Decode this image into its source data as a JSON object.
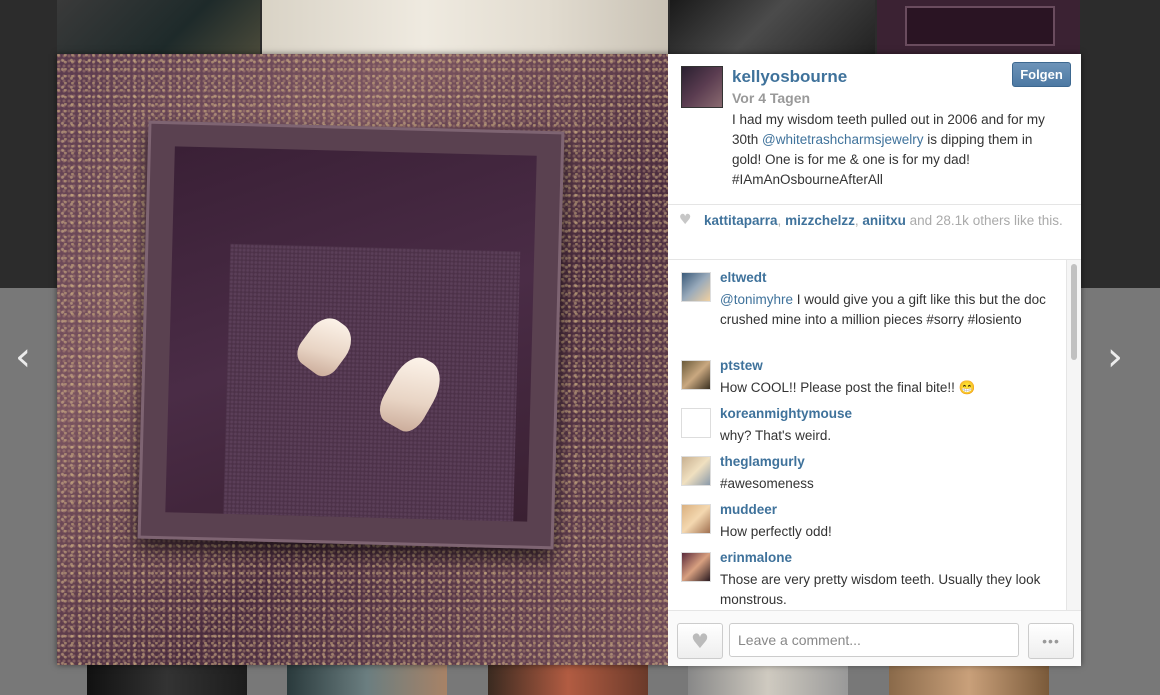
{
  "post": {
    "author": "kellyosbourne",
    "time": "Vor 4 Tagen",
    "follow_label": "Folgen",
    "caption_part1": "I had my wisdom teeth pulled out in 2006 and for my 30th ",
    "caption_mention": "@whitetrashcharmsjewelry",
    "caption_part2": " is dipping them in gold! One is for me & one is for my dad! #IAmAnOsbourneAfterAll"
  },
  "likes": {
    "icon": "heart-icon",
    "user1": "kattitaparra",
    "user2": "mizzchelzz",
    "user3": "aniitxu",
    "sep": ", ",
    "and": " and ",
    "count": "28.1k",
    "tail": " others like this."
  },
  "comments": [
    {
      "user": "eltwedt",
      "mention": "@tonimyhre",
      "text": " I would give you a gift like this but the doc crushed mine into a million pieces #sorry #losiento"
    },
    {
      "user": "ptstew",
      "text": "How COOL!! Please post the final bite!! 😁"
    },
    {
      "user": "koreanmightymouse",
      "text": "why? That's weird."
    },
    {
      "user": "theglamgurly",
      "text": "#awesomeness"
    },
    {
      "user": "muddeer",
      "text": "How perfectly odd!"
    },
    {
      "user": "erinmalone",
      "text": "Those are very pretty wisdom teeth. Usually they look monstrous."
    }
  ],
  "footer": {
    "like_icon": "heart-icon",
    "comment_placeholder": "Leave a comment...",
    "more_label": "•••"
  },
  "nav": {
    "prev_icon": "‹",
    "next_icon": "›"
  },
  "colors": {
    "link": "#3f729b",
    "follow_button": "#4d79a3"
  }
}
